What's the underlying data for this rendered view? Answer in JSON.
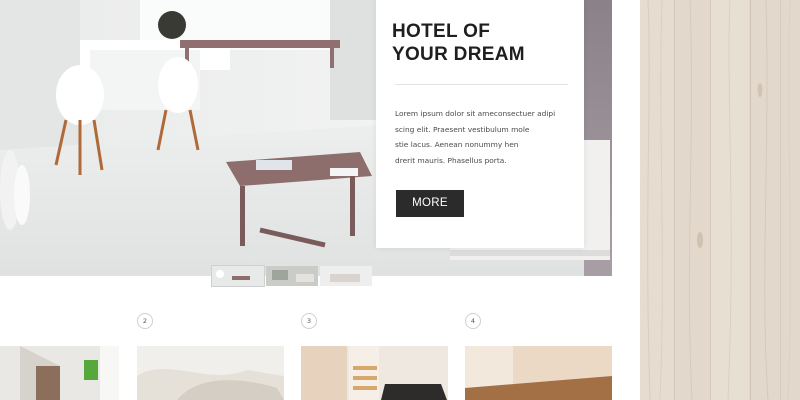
{
  "hero": {
    "title_lines": [
      "HOTEL OF",
      "YOUR DREAM"
    ],
    "body_lines": [
      "Lorem ipsum dolor sit ameconsectuer adipi",
      "scing elit. Praesent vestibulum mole",
      "stie lacus. Aenean nonummy hen",
      "drerit mauris. Phasellus porta."
    ],
    "button_label": "MORE"
  },
  "slider_thumbnails": [
    {
      "name": "slide-1",
      "active": true
    },
    {
      "name": "slide-2",
      "active": false
    },
    {
      "name": "slide-3",
      "active": false
    }
  ],
  "room_badges": [
    "2",
    "3",
    "4"
  ],
  "colors": {
    "button_bg": "#2b2b2b",
    "button_text": "#ffffff",
    "title_text": "#1f1f1f",
    "body_text": "#4a4a4a",
    "wood_panel": "#e3d8cc"
  }
}
